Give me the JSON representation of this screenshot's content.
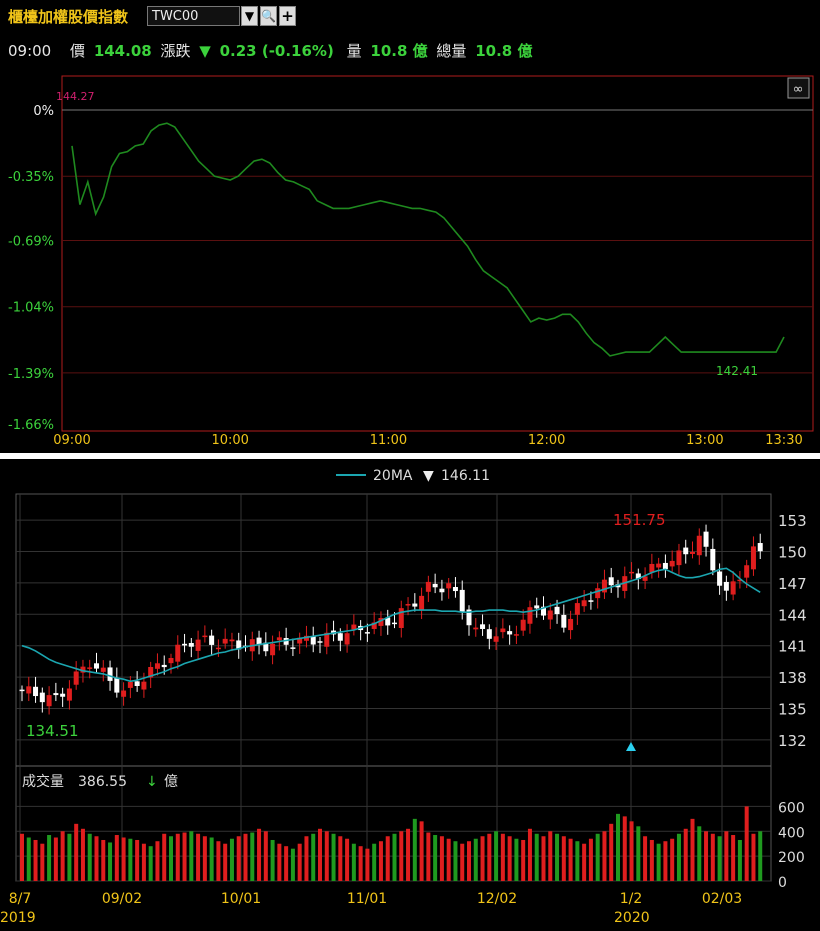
{
  "header": {
    "title": "櫃檯加權股價指數",
    "symbol": "TWC00",
    "time": "09:00",
    "price_label": "價",
    "price": "144.08",
    "change_label": "漲跌",
    "change_arrow": "▼",
    "change": "0.23 (-0.16%)",
    "volume_label": "量",
    "volume": "10.8 億",
    "total_volume_label": "總量",
    "total_volume": "10.8 億"
  },
  "colors": {
    "line": "#1f8a1f",
    "up": "#e01e1e",
    "down": "#ffffff",
    "vol_down": "#1f9a1f",
    "ma": "#1ba6b0",
    "frame": "#b01c1c",
    "axis_text": "#f0c419"
  },
  "intraday_chart": {
    "type": "line",
    "ref_price_label": "144.27",
    "low_label": "142.41",
    "y_ticks": [
      "0%",
      "-0.35%",
      "-0.69%",
      "-1.04%",
      "-1.39%",
      "-1.66%"
    ],
    "x_ticks": [
      "09:00",
      "10:00",
      "11:00",
      "12:00",
      "13:00",
      "13:30"
    ],
    "ylim": [
      -1.66,
      0
    ],
    "x": [
      0,
      3,
      6,
      9,
      12,
      15,
      18,
      21,
      24,
      27,
      30,
      33,
      36,
      39,
      42,
      45,
      48,
      51,
      54,
      57,
      60,
      63,
      66,
      69,
      72,
      75,
      78,
      81,
      84,
      87,
      90,
      93,
      96,
      99,
      102,
      105,
      108,
      111,
      114,
      117,
      120,
      123,
      126,
      129,
      132,
      135,
      138,
      141,
      144,
      147,
      150,
      153,
      156,
      159,
      162,
      165,
      168,
      171,
      174,
      177,
      180,
      183,
      186,
      189,
      192,
      195,
      198,
      201,
      204,
      207,
      210,
      213,
      216,
      219,
      222,
      225,
      228,
      231,
      234,
      237,
      240,
      243,
      246,
      249,
      252,
      255,
      258,
      261,
      264,
      267,
      270
    ],
    "values": [
      -0.19,
      -0.5,
      -0.38,
      -0.55,
      -0.46,
      -0.3,
      -0.23,
      -0.22,
      -0.19,
      -0.18,
      -0.11,
      -0.08,
      -0.07,
      -0.09,
      -0.15,
      -0.21,
      -0.27,
      -0.31,
      -0.35,
      -0.36,
      -0.37,
      -0.35,
      -0.31,
      -0.27,
      -0.26,
      -0.28,
      -0.33,
      -0.37,
      -0.38,
      -0.4,
      -0.42,
      -0.48,
      -0.5,
      -0.52,
      -0.52,
      -0.52,
      -0.51,
      -0.5,
      -0.49,
      -0.48,
      -0.49,
      -0.5,
      -0.51,
      -0.52,
      -0.52,
      -0.53,
      -0.54,
      -0.57,
      -0.62,
      -0.67,
      -0.72,
      -0.79,
      -0.85,
      -0.88,
      -0.91,
      -0.94,
      -1.0,
      -1.06,
      -1.12,
      -1.1,
      -1.11,
      -1.1,
      -1.08,
      -1.08,
      -1.12,
      -1.18,
      -1.23,
      -1.26,
      -1.3,
      -1.29,
      -1.28,
      -1.28,
      -1.28,
      -1.28,
      -1.24,
      -1.2,
      -1.24,
      -1.28,
      -1.28,
      -1.28,
      -1.28,
      -1.28,
      -1.28,
      -1.28,
      -1.28,
      -1.28,
      -1.28,
      -1.28,
      -1.28,
      -1.28,
      -1.2
    ]
  },
  "daily_chart": {
    "type": "candlestick",
    "ma_label": "20MA",
    "ma_arrow": "▼",
    "ma_value": "146.11",
    "high_label": "151.75",
    "low_label": "134.51",
    "y_ticks": [
      "153",
      "150",
      "147",
      "144",
      "141",
      "138",
      "135",
      "132"
    ],
    "ylim": [
      129.5,
      155.5
    ],
    "x_ticks": [
      "8/7",
      "09/02",
      "10/01",
      "11/01",
      "12/02",
      "1/2",
      "02/03"
    ],
    "year_labels": [
      "2019",
      "2020"
    ],
    "candles": [],
    "ma20": [
      141.0,
      140.8,
      140.5,
      140.1,
      139.7,
      139.4,
      139.2,
      139.0,
      138.8,
      138.6,
      138.5,
      138.4,
      138.3,
      138.1,
      137.9,
      137.8,
      137.6,
      137.7,
      137.9,
      138.1,
      138.3,
      138.5,
      138.8,
      139.0,
      139.3,
      139.5,
      139.7,
      139.9,
      140.1,
      140.3,
      140.4,
      140.6,
      140.7,
      140.9,
      141.0,
      141.1,
      141.2,
      141.3,
      141.4,
      141.5,
      141.6,
      141.7,
      141.8,
      141.9,
      142.0,
      142.1,
      142.2,
      142.3,
      142.4,
      142.5,
      142.7,
      142.9,
      143.1,
      143.4,
      143.7,
      144.0,
      144.2,
      144.3,
      144.4,
      144.4,
      144.4,
      144.4,
      144.3,
      144.3,
      144.3,
      144.2,
      144.2,
      144.3,
      144.3,
      144.4,
      144.4,
      144.4,
      144.3,
      144.3,
      144.2,
      144.3,
      144.4,
      144.6,
      144.8,
      145.0,
      145.2,
      145.4,
      145.6,
      145.8,
      146.0,
      146.2,
      146.4,
      146.6,
      146.8,
      147.0,
      147.2,
      147.4,
      147.7,
      148.0,
      148.2,
      148.3,
      148.0,
      147.7,
      147.5,
      147.5,
      147.6,
      147.8,
      148.0,
      148.3,
      148.4,
      148.0,
      147.4,
      146.9,
      146.5,
      146.1
    ],
    "volume_label": "成交量",
    "volume_value": "386.55",
    "volume_arrow": "↓",
    "volume_unit": "億",
    "volume_ticks": [
      "600",
      "400",
      "200",
      "0"
    ],
    "volumes": [
      380,
      350,
      330,
      300,
      370,
      350,
      400,
      380,
      460,
      420,
      380,
      360,
      330,
      310,
      370,
      350,
      340,
      330,
      300,
      280,
      320,
      380,
      360,
      380,
      390,
      400,
      380,
      360,
      350,
      320,
      300,
      340,
      360,
      380,
      390,
      420,
      400,
      330,
      300,
      280,
      260,
      300,
      360,
      380,
      420,
      400,
      380,
      360,
      340,
      300,
      280,
      260,
      300,
      320,
      360,
      380,
      400,
      420,
      500,
      480,
      390,
      370,
      360,
      340,
      320,
      300,
      320,
      340,
      360,
      380,
      400,
      380,
      360,
      340,
      330,
      420,
      380,
      360,
      400,
      380,
      360,
      340,
      320,
      300,
      340,
      380,
      400,
      460,
      540,
      520,
      480,
      440,
      360,
      330,
      300,
      320,
      340,
      380,
      420,
      500,
      440,
      400,
      380,
      360,
      400,
      370,
      330,
      600,
      380,
      400,
      390,
      380
    ]
  }
}
